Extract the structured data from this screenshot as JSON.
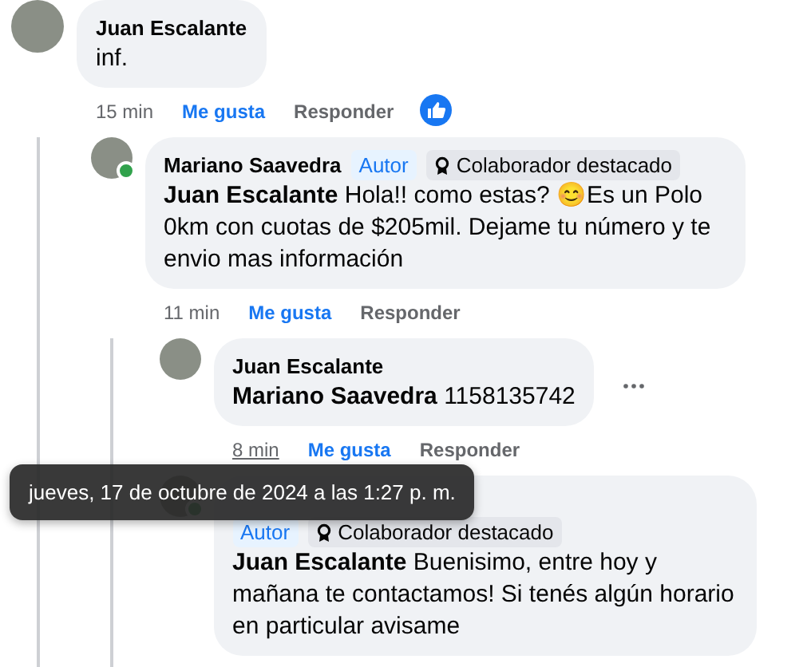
{
  "comments": [
    {
      "author": "Juan Escalante",
      "text": "inf.",
      "time": "15 min",
      "liked": true,
      "like_label": "Me gusta",
      "reply_label": "Responder",
      "liked_by_reaction": true,
      "children": [
        {
          "author": "Mariano Saavedra",
          "online": true,
          "badges": [
            {
              "kind": "author",
              "label": "Autor"
            },
            {
              "kind": "top-fan",
              "label": "Colaborador destacado"
            }
          ],
          "text": "**Juan Escalante** Hola!! como estas? 😊Es un Polo 0km con cuotas de $205mil. Dejame tu número y te envio mas información",
          "time": "11 min",
          "liked": true,
          "like_label": "Me gusta",
          "reply_label": "Responder",
          "children": [
            {
              "author": "Juan Escalante",
              "text": "**Mariano Saavedra** 1158135742",
              "time": "8 min",
              "hovered": true,
              "liked": true,
              "like_label": "Me gusta",
              "reply_label": "Responder",
              "more_button": true
            },
            {
              "online": true,
              "badges": [
                {
                  "kind": "author",
                  "label": "Autor"
                },
                {
                  "kind": "top-fan",
                  "label": "Colaborador destacado"
                }
              ],
              "text": "**Juan Escalante** Buenisimo, entre hoy y mañana te contactamos! Si tenés algún horario en particular avisame"
            }
          ]
        }
      ]
    }
  ],
  "tooltip": {
    "text": "jueves, 17 de octubre de 2024 a las 1:27 p. m."
  }
}
